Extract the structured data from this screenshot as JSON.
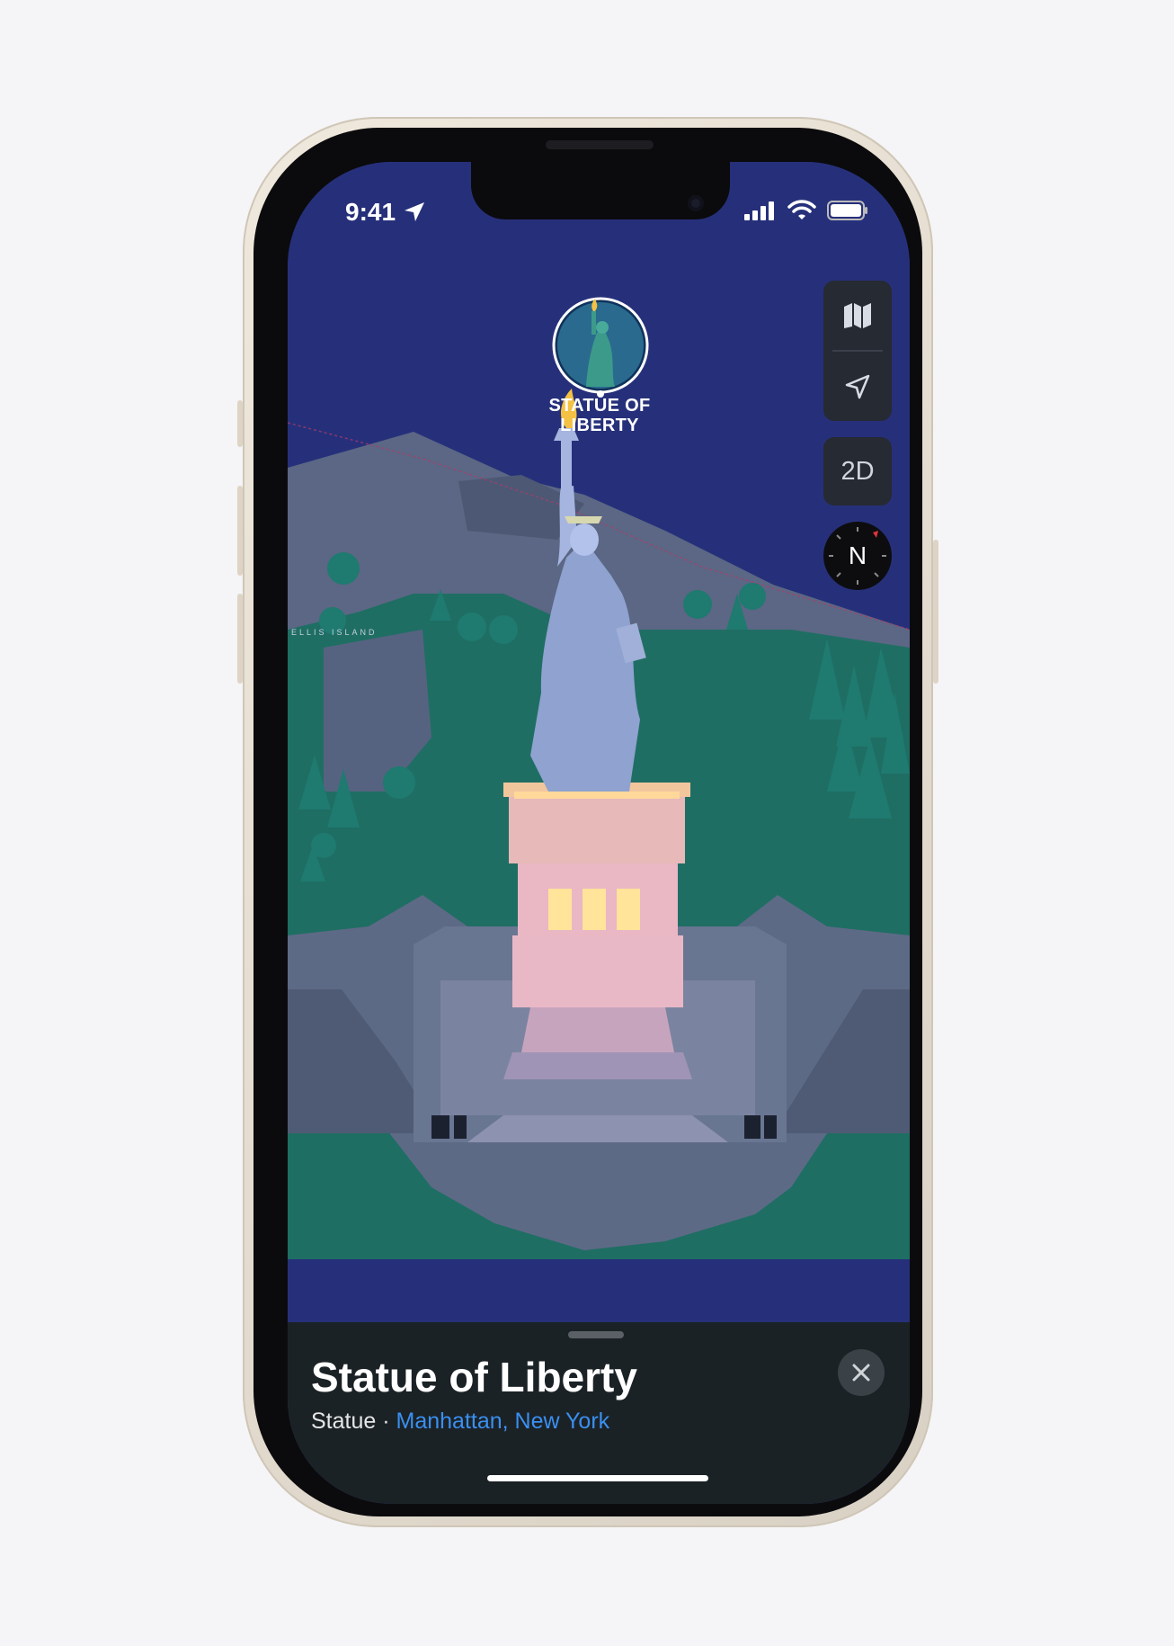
{
  "status_bar": {
    "time": "9:41"
  },
  "map": {
    "pin_label_line1": "STATUE OF",
    "pin_label_line2": "LIBERTY",
    "island_label": "ELLIS ISLAND"
  },
  "controls": {
    "map_mode_icon": "map-icon",
    "location_icon": "location-arrow-icon",
    "view_toggle_label": "2D",
    "compass_label": "N"
  },
  "place_card": {
    "title": "Statue of Liberty",
    "category": "Statue",
    "separator": " · ",
    "location": "Manhattan, New York"
  },
  "colors": {
    "sky": "#26307a",
    "land": "#5d6a86",
    "grass": "#1f6e63",
    "link_blue": "#3a8ff0",
    "sheet": "#1b2226"
  }
}
